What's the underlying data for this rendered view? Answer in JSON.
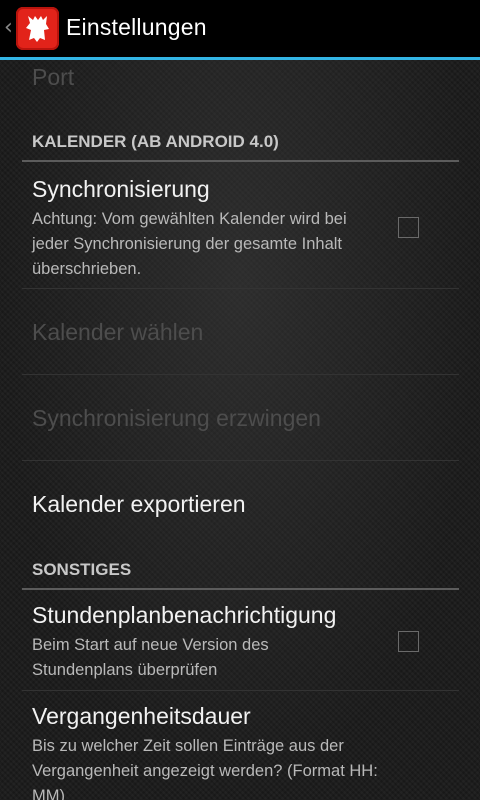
{
  "actionbar": {
    "title": "Einstellungen",
    "icons": {
      "back": "chevron-left-icon",
      "app": "berlin-bear-icon"
    },
    "accent_color": "#33b5e5",
    "app_icon_color": "#e2231a"
  },
  "prefs": {
    "port": {
      "title": "Port"
    },
    "calendar_category": "KALENDER (AB ANDROID 4.0)",
    "sync": {
      "title": "Synchronisierung",
      "summary": "Achtung: Vom gewählten Kalender wird bei jeder Synchronisierung der gesamte Inhalt überschrieben.",
      "checked": false
    },
    "choose_calendar": {
      "title": "Kalender wählen"
    },
    "force_sync": {
      "title": "Synchronisierung erzwingen"
    },
    "export_calendar": {
      "title": "Kalender exportieren"
    },
    "misc_category": "SONSTIGES",
    "timetable_notify": {
      "title": "Stundenplanbenachrichtigung",
      "summary": "Beim Start auf neue Version des Stundenplans überprüfen",
      "checked": false
    },
    "past_duration": {
      "title": "Vergangenheitsdauer",
      "summary": "Bis zu welcher Zeit sollen Einträge aus der Vergangenheit angezeigt werden? (Format HH: MM)"
    }
  }
}
